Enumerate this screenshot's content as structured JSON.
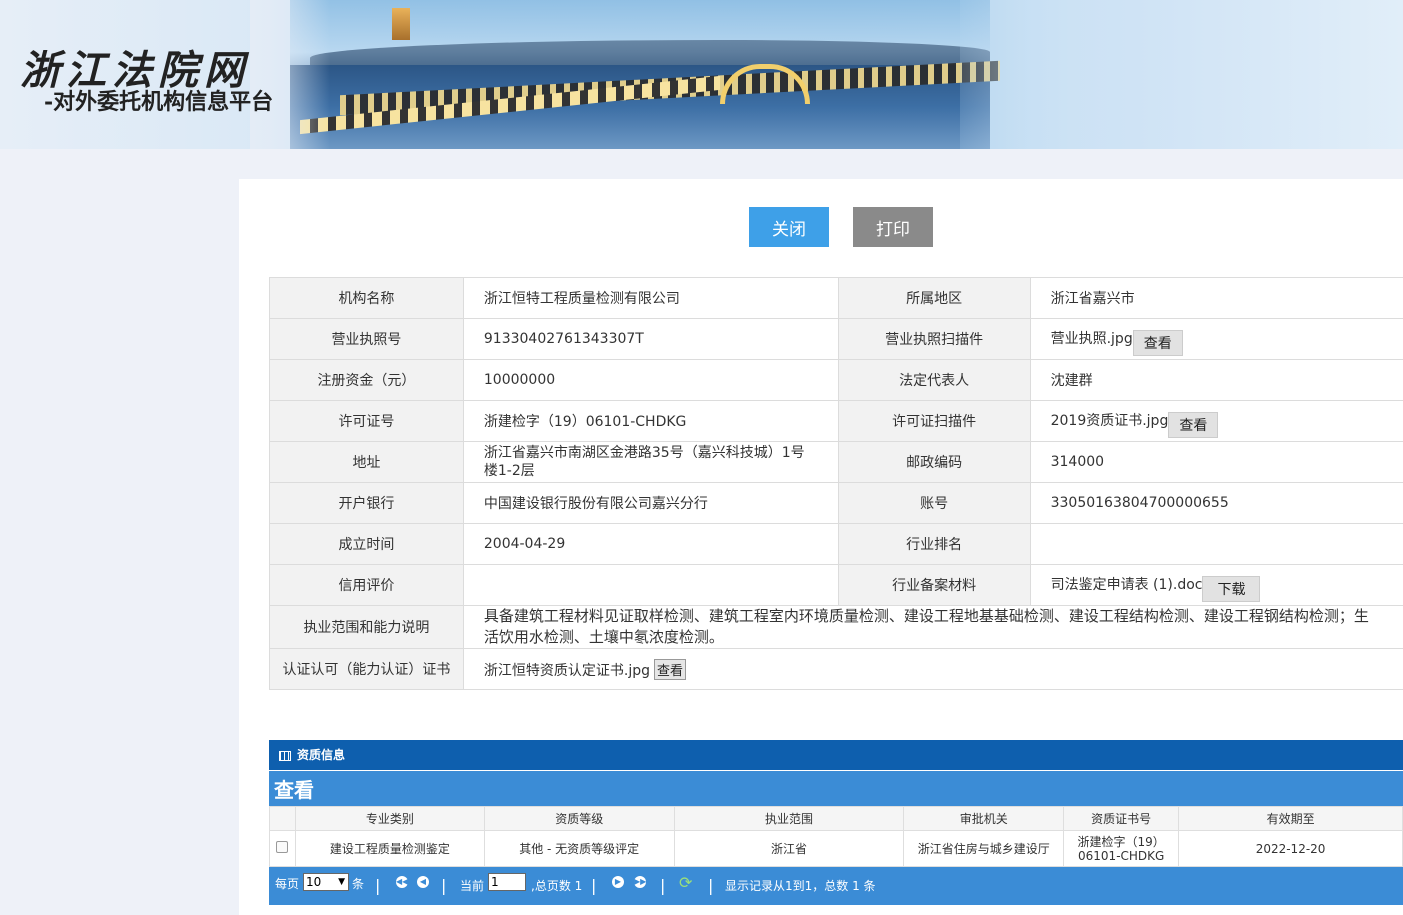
{
  "header": {
    "title": "浙江法院网",
    "subtitle": "-对外委托机构信息平台"
  },
  "actions": {
    "close_label": "关闭",
    "print_label": "打印"
  },
  "info": {
    "org_name_label": "机构名称",
    "org_name": "浙江恒特工程质量检测有限公司",
    "region_label": "所属地区",
    "region": "浙江省嘉兴市",
    "license_no_label": "营业执照号",
    "license_no": "91330402761343307T",
    "license_scan_label": "营业执照扫描件",
    "license_scan_file": "营业执照.jpg",
    "view_label": "查看",
    "capital_label": "注册资金（元）",
    "capital": "10000000",
    "legal_rep_label": "法定代表人",
    "legal_rep": "沈建群",
    "permit_no_label": "许可证号",
    "permit_no": "浙建检字（19）06101-CHDKG",
    "permit_scan_label": "许可证扫描件",
    "permit_scan_file": "2019资质证书.jpg",
    "address_label": "地址",
    "address": "浙江省嘉兴市南湖区金港路35号（嘉兴科技城）1号楼1-2层",
    "postcode_label": "邮政编码",
    "postcode": "314000",
    "bank_label": "开户银行",
    "bank": "中国建设银行股份有限公司嘉兴分行",
    "account_label": "账号",
    "account": "33050163804700000655",
    "founded_label": "成立时间",
    "founded": "2004-04-29",
    "rank_label": "行业排名",
    "rank": "",
    "credit_label": "信用评价",
    "credit": "",
    "filing_label": "行业备案材料",
    "filing_file": "司法鉴定申请表 (1).doc",
    "download_label": "下载",
    "scope_label": "执业范围和能力说明",
    "scope": "具备建筑工程材料见证取样检测、建筑工程室内环境质量检测、建设工程地基基础检测、建设工程结构检测、建设工程钢结构检测；生活饮用水检测、土壤中氡浓度检测。",
    "cert_label": "认证认可（能力认证）证书",
    "cert_file": "浙江恒特资质认定证书.jpg",
    "cert_view_label": "查看"
  },
  "qualification": {
    "panel_title": "资质信息",
    "view_title": "查看",
    "columns": [
      "专业类别",
      "资质等级",
      "执业范围",
      "审批机关",
      "资质证书号",
      "有效期至"
    ],
    "rows": [
      {
        "category": "建设工程质量检测鉴定",
        "level": "其他 - 无资质等级评定",
        "scope": "浙江省",
        "authority": "浙江省住房与城乡建设厅",
        "cert_no_line1": "浙建检字（19）",
        "cert_no_line2": "06101-CHDKG",
        "valid_until": "2022-12-20"
      }
    ],
    "pager": {
      "per_page_prefix": "每页",
      "per_page_value": "10",
      "per_page_suffix": "条",
      "current_label": "当前",
      "current_page": "1",
      "total_pages_label": ",总页数 1",
      "summary": "显示记录从1到1，总数 1 条"
    }
  }
}
